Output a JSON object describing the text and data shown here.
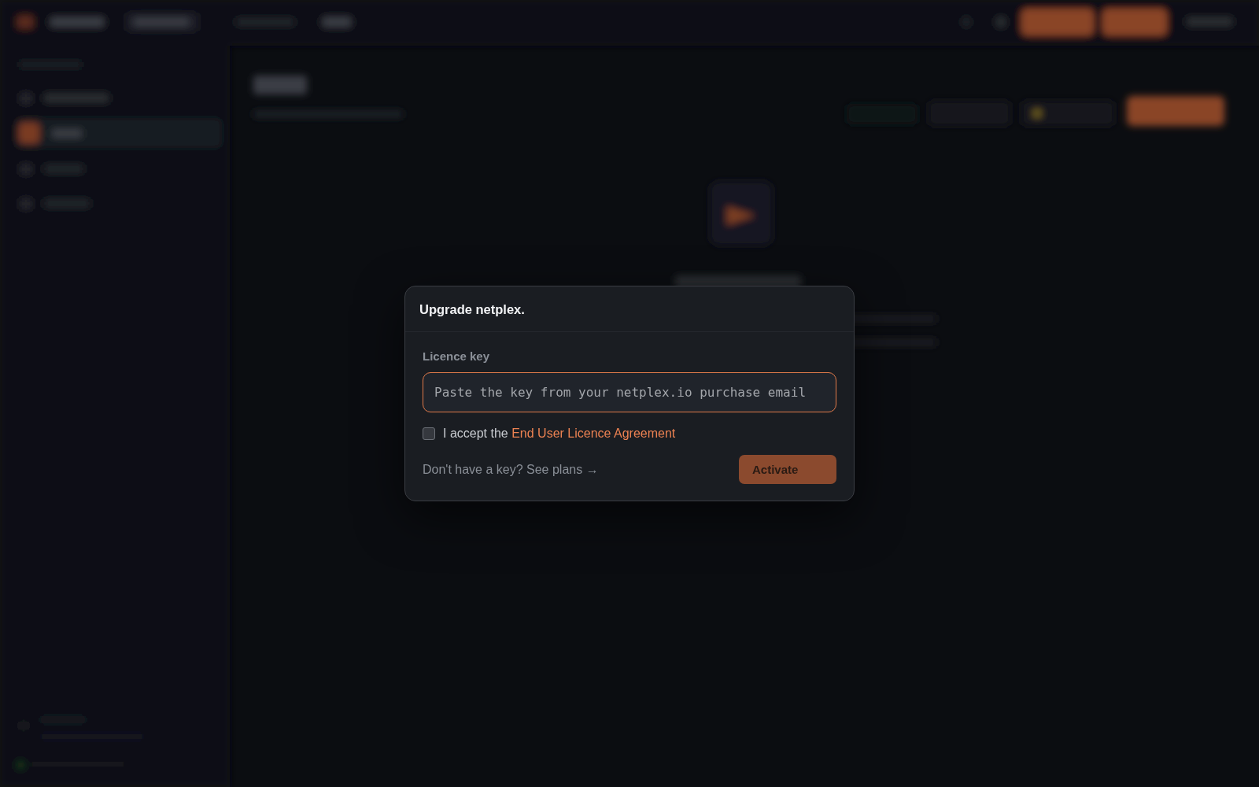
{
  "dialog": {
    "title": "Upgrade netplex.",
    "field": {
      "label": "Licence key",
      "placeholder": "Paste the key from your netplex.io purchase email",
      "focused": true
    },
    "agreement": {
      "checked": false,
      "text": "I accept the",
      "link": "End User Licence Agreement"
    },
    "footer": {
      "text": "Don't have a key?",
      "link": "See plans →"
    },
    "button": {
      "label": "Activate",
      "disabled": true
    }
  }
}
